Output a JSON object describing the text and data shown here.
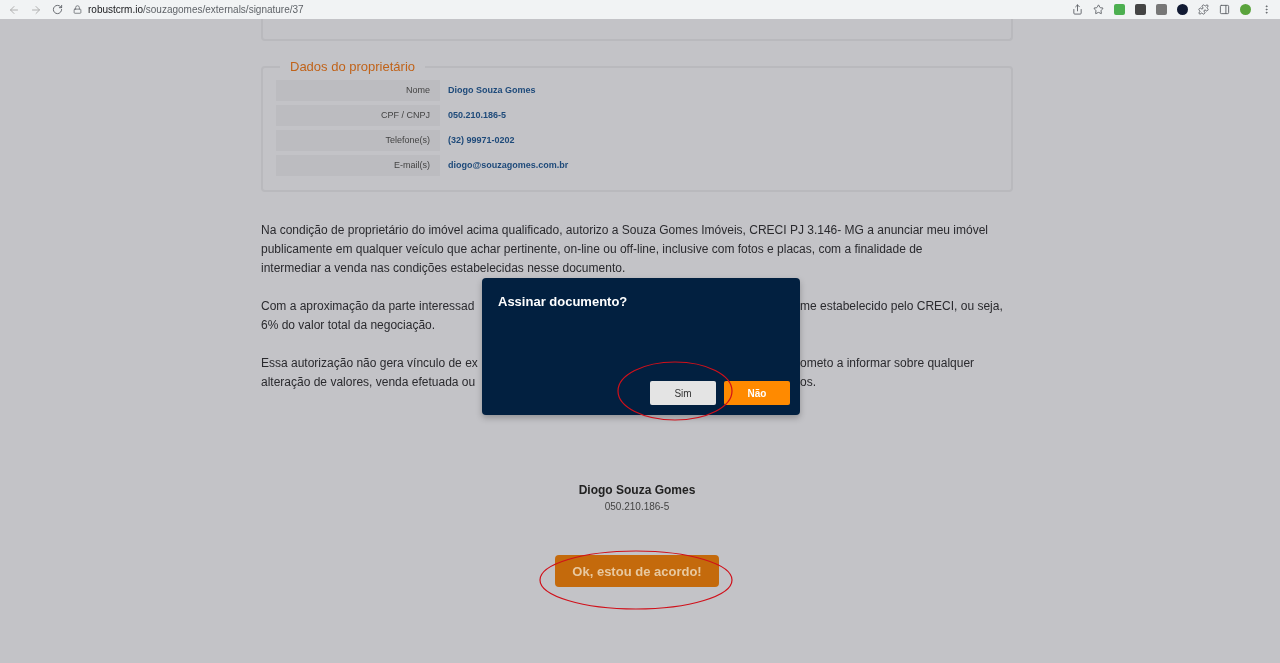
{
  "browser": {
    "url_host": "robustcrm.io",
    "url_path": "/souzagomes/externals/signature/37"
  },
  "owner_section": {
    "title": "Dados do proprietário",
    "fields": [
      {
        "label": "Nome",
        "value": "Diogo Souza Gomes"
      },
      {
        "label": "CPF / CNPJ",
        "value": "050.210.186-5"
      },
      {
        "label": "Telefone(s)",
        "value": "(32) 99971-0202"
      },
      {
        "label": "E-mail(s)",
        "value": "diogo@souzagomes.com.br"
      }
    ]
  },
  "paragraphs": [
    {
      "lines": [
        {
          "kind": "full",
          "text": "Na condição de proprietário do imóvel acima qualificado, autorizo a Souza Gomes Imóveis, CRECI PJ 3.146- MG a anunciar meu imóvel"
        },
        {
          "kind": "full",
          "text": "publicamente em qualquer veículo que achar pertinente, on-line ou off-line, inclusive com fotos e placas, com a finalidade de"
        },
        {
          "kind": "full",
          "text": "intermediar a venda nas condições estabelecidas nesse documento."
        }
      ]
    },
    {
      "lines": [
        {
          "kind": "split",
          "left": "Com a aproximação da parte interessad",
          "right": "me estabelecido pelo CRECI, ou seja,"
        },
        {
          "kind": "full",
          "text": "6% do valor total da negociação."
        }
      ]
    },
    {
      "lines": [
        {
          "kind": "split",
          "left": "Essa autorização não gera vínculo de ex",
          "right": "ometo a informar sobre qualquer"
        },
        {
          "kind": "split",
          "left": "alteração de valores, venda efetuada ou",
          "right": "os."
        }
      ]
    }
  ],
  "signer": {
    "name": "Diogo Souza Gomes",
    "document": "050.210.186-5"
  },
  "agree_button": "Ok, estou de acordo!",
  "dialog": {
    "title": "Assinar documento?",
    "buttons": [
      {
        "label": "Sim",
        "kind": "secondary"
      },
      {
        "label": "Não",
        "kind": "primary"
      }
    ]
  }
}
